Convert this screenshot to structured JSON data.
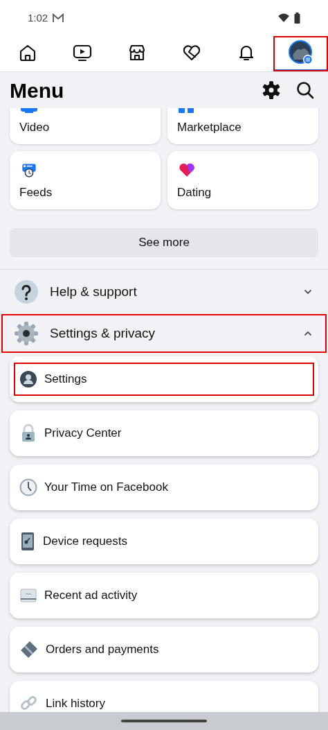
{
  "status_bar": {
    "time": "1:02"
  },
  "tabs": [
    {
      "kind": "home",
      "selected": false,
      "highlighted": false
    },
    {
      "kind": "video",
      "selected": false,
      "highlighted": false
    },
    {
      "kind": "marketplace",
      "selected": false,
      "highlighted": false
    },
    {
      "kind": "dating",
      "selected": false,
      "highlighted": false
    },
    {
      "kind": "notifications",
      "selected": false,
      "highlighted": false
    },
    {
      "kind": "menu",
      "selected": true,
      "highlighted": true
    }
  ],
  "header": {
    "title": "Menu"
  },
  "shortcuts": [
    {
      "kind": "video",
      "label": "Video"
    },
    {
      "kind": "marketplace",
      "label": "Marketplace"
    },
    {
      "kind": "feeds",
      "label": "Feeds"
    },
    {
      "kind": "dating",
      "label": "Dating"
    }
  ],
  "see_more": "See more",
  "sections": [
    {
      "kind": "help",
      "label": "Help & support",
      "expanded": false,
      "highlighted": false
    },
    {
      "kind": "settings",
      "label": "Settings & privacy",
      "expanded": true,
      "highlighted": true
    }
  ],
  "items": [
    {
      "kind": "profile",
      "label": "Settings",
      "highlighted": true
    },
    {
      "kind": "lock",
      "label": "Privacy Center",
      "highlighted": false
    },
    {
      "kind": "clock",
      "label": "Your Time on Facebook",
      "highlighted": false
    },
    {
      "kind": "phone",
      "label": "Device requests",
      "highlighted": false
    },
    {
      "kind": "ads",
      "label": "Recent ad activity",
      "highlighted": false
    },
    {
      "kind": "card",
      "label": "Orders and payments",
      "highlighted": false
    },
    {
      "kind": "link",
      "label": "Link history",
      "highlighted": false
    }
  ]
}
